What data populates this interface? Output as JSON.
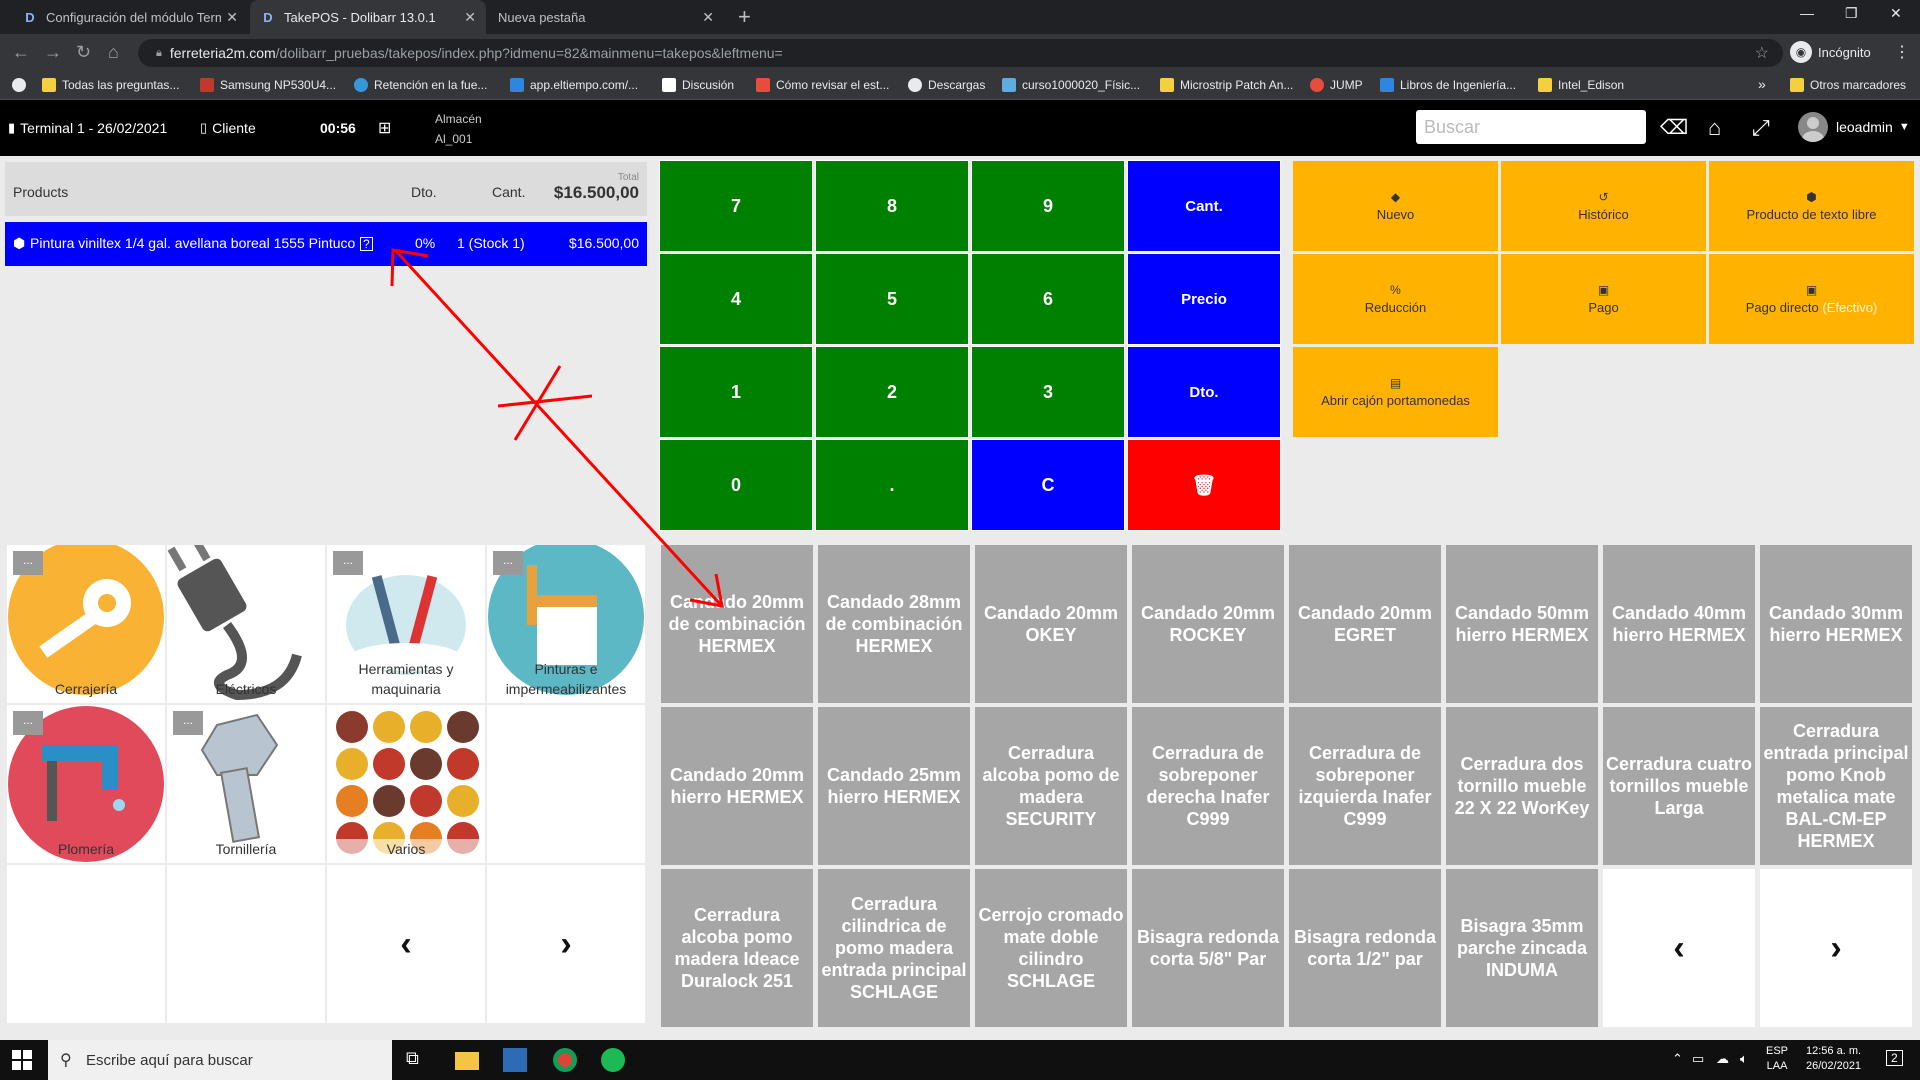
{
  "browser": {
    "tabs": [
      {
        "title": "Configuración del módulo Termi",
        "active": false
      },
      {
        "title": "TakePOS - Dolibarr 13.0.1",
        "active": true
      },
      {
        "title": "Nueva pestaña",
        "active": false
      }
    ],
    "url_host": "ferreteria2m.com",
    "url_path": "/dolibarr_pruebas/takepos/index.php?idmenu=82&mainmenu=takepos&leftmenu=",
    "profile_label": "Incógnito",
    "bookmarks": [
      "Todas las preguntas...",
      "Samsung NP530U4...",
      "Retención en la fue...",
      "app.eltiempo.com/...",
      "Discusión",
      "Cómo revisar el est...",
      "Descargas",
      "curso1000020_Físic...",
      "Microstrip Patch An...",
      "JUMP",
      "Libros de Ingeniería...",
      "Intel_Edison"
    ],
    "bookmarks_more": "»",
    "other_bookmarks": "Otros marcadores"
  },
  "pos": {
    "terminal": "Terminal 1 - 26/02/2021",
    "customer": "Cliente",
    "clock": "00:56",
    "warehouse_label": "Almacén",
    "warehouse_value": "Al_001",
    "search_placeholder": "Buscar",
    "user": "leoadmin",
    "ticket": {
      "col_products": "Products",
      "col_discount": "Dto.",
      "col_qty": "Cant.",
      "total_label": "Total",
      "total_value": "$16.500,00",
      "line": {
        "name": "Pintura viniltex 1/4 gal. avellana boreal 1555 Pintuco",
        "discount": "0%",
        "qty": "1 (Stock 1)",
        "price": "$16.500,00"
      }
    },
    "keypad": {
      "k7": "7",
      "k8": "8",
      "k9": "9",
      "qty": "Cant.",
      "k4": "4",
      "k5": "5",
      "k6": "6",
      "price": "Precio",
      "k1": "1",
      "k2": "2",
      "k3": "3",
      "discount": "Dto.",
      "k0": "0",
      "dot": ".",
      "clear": "C"
    },
    "actions": {
      "new": "Nuevo",
      "history": "Histórico",
      "free_product": "Producto de texto libre",
      "reduction": "Reducción",
      "payment": "Pago",
      "direct_payment": "Pago directo",
      "direct_payment_sub": "(Efectivo)",
      "open_drawer": "Abrir cajón portamonedas"
    },
    "categories": [
      {
        "label": "Cerrajería"
      },
      {
        "label": "Eléctricos"
      },
      {
        "label": "Herramientas y maquinaria"
      },
      {
        "label": "Pinturas e impermeabilizantes"
      },
      {
        "label": "Plomería"
      },
      {
        "label": "Tornillería"
      },
      {
        "label": "Varios"
      }
    ],
    "dots_label": "...",
    "prev": "‹",
    "next": "›",
    "products": [
      "Candado 20mm de combinación HERMEX",
      "Candado 28mm de combinación HERMEX",
      "Candado 20mm OKEY",
      "Candado 20mm ROCKEY",
      "Candado 20mm EGRET",
      "Candado 50mm hierro HERMEX",
      "Candado 40mm hierro HERMEX",
      "Candado 30mm hierro HERMEX",
      "Candado 20mm hierro HERMEX",
      "Candado 25mm hierro HERMEX",
      "Cerradura alcoba pomo de madera SECURITY",
      "Cerradura de sobreponer derecha Inafer C999",
      "Cerradura de sobreponer izquierda Inafer C999",
      "Cerradura dos tornillo mueble 22 X 22 WorKey",
      "Cerradura cuatro tornillos mueble Larga",
      "Cerradura entrada principal pomo Knob metalica mate BAL-CM-EP HERMEX",
      "Cerradura alcoba pomo madera Ideace Duralock 251",
      "Cerradura cilindrica de pomo madera entrada principal SCHLAGE",
      "Cerrojo cromado mate doble cilindro SCHLAGE",
      "Bisagra redonda corta 5/8\" Par",
      "Bisagra redonda corta 1/2\" par",
      "Bisagra 35mm parche zincada INDUMA"
    ]
  },
  "taskbar": {
    "search_placeholder": "Escribe aquí para buscar",
    "lang": "ESP",
    "layout": "LAA",
    "time": "12:56 a. m.",
    "date": "26/02/2021",
    "notifications": "2"
  },
  "colors": {
    "numkey": "#008000",
    "bluekey": "#0000ff",
    "deletekey": "#ff0000",
    "actionkey": "#ffb300",
    "product": "#a6a6a6",
    "annotation": "#ff0000"
  }
}
